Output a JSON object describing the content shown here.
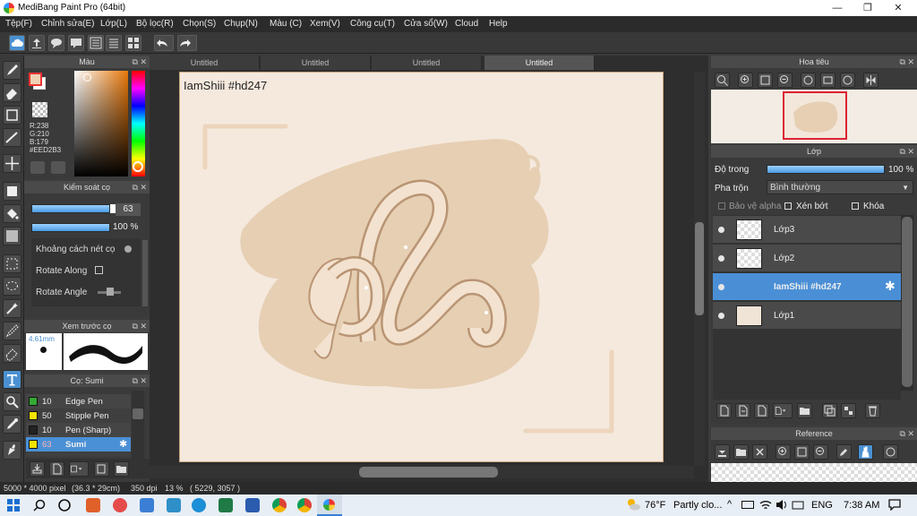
{
  "window": {
    "title": "MediBang Paint Pro (64bit)",
    "minimize": "—",
    "maximize": "❐",
    "close": "✕"
  },
  "menu": [
    "Tệp(F)",
    "Chỉnh sửa(E)",
    "Lớp(L)",
    "Bộ lọc(R)",
    "Chọn(S)",
    "Chụp(N)",
    "Màu (C)",
    "Xem(V)",
    "Công cụ(T)",
    "Cửa sổ(W)",
    "Cloud",
    "Help"
  ],
  "color_panel": {
    "title": "Màu",
    "r": "R:238",
    "g": "G:210",
    "b": "B:179",
    "hex": "#EED2B3",
    "primary_color": "#EED2B3",
    "secondary_color": "#ffffff"
  },
  "brush_control": {
    "title": "Kiểm soát cọ",
    "size_value": "63",
    "opacity_value": "100 %",
    "spacing_label": "Khoảng cách nét cọ",
    "rotate_along_label": "Rotate Along",
    "rotate_angle_label": "Rotate Angle"
  },
  "brush_preview": {
    "title": "Xem trước cọ",
    "size": "4.61mm"
  },
  "brush_list": {
    "title": "Cọ: Sumi",
    "items": [
      {
        "size": "10",
        "name": "Edge Pen",
        "color": "#33aa33"
      },
      {
        "size": "50",
        "name": "Stipple Pen",
        "color": "#f2e200"
      },
      {
        "size": "10",
        "name": "Pen (Sharp)",
        "color": "#222222"
      },
      {
        "size": "63",
        "name": "Sumi",
        "color": "#f2e200"
      }
    ]
  },
  "doc_tabs": [
    "Untitled",
    "Untitled",
    "Untitled",
    "Untitled"
  ],
  "canvas": {
    "watermark": "IamShiii #hd247",
    "paper_color": "#f5e9de",
    "blob_color": "#e6cfb3"
  },
  "navigator": {
    "title": "Hoa tiêu"
  },
  "layers": {
    "title": "Lớp",
    "opacity_label": "Độ trong",
    "opacity_value": "100 %",
    "blend_label": "Pha trộn",
    "blend_value": "Bình thường",
    "protect_alpha": "Bảo vệ alpha",
    "clipping": "Xén bớt",
    "lock": "Khóa",
    "items": [
      {
        "name": "Lớp3",
        "selected": false
      },
      {
        "name": "Lớp2",
        "selected": false
      },
      {
        "name": "IamShiii #hd247",
        "selected": true
      },
      {
        "name": "Lớp1",
        "selected": false
      }
    ]
  },
  "reference": {
    "title": "Reference"
  },
  "status": {
    "size": "5000 * 4000 pixel",
    "physical": "(36.3 * 29cm)",
    "dpi": "350 dpi",
    "zoom": "13 %",
    "coords": "( 5229, 3057 )"
  },
  "taskbar": {
    "temp": "76°F",
    "weather": "Partly clo...",
    "lang": "ENG",
    "time": "7:38 AM"
  }
}
